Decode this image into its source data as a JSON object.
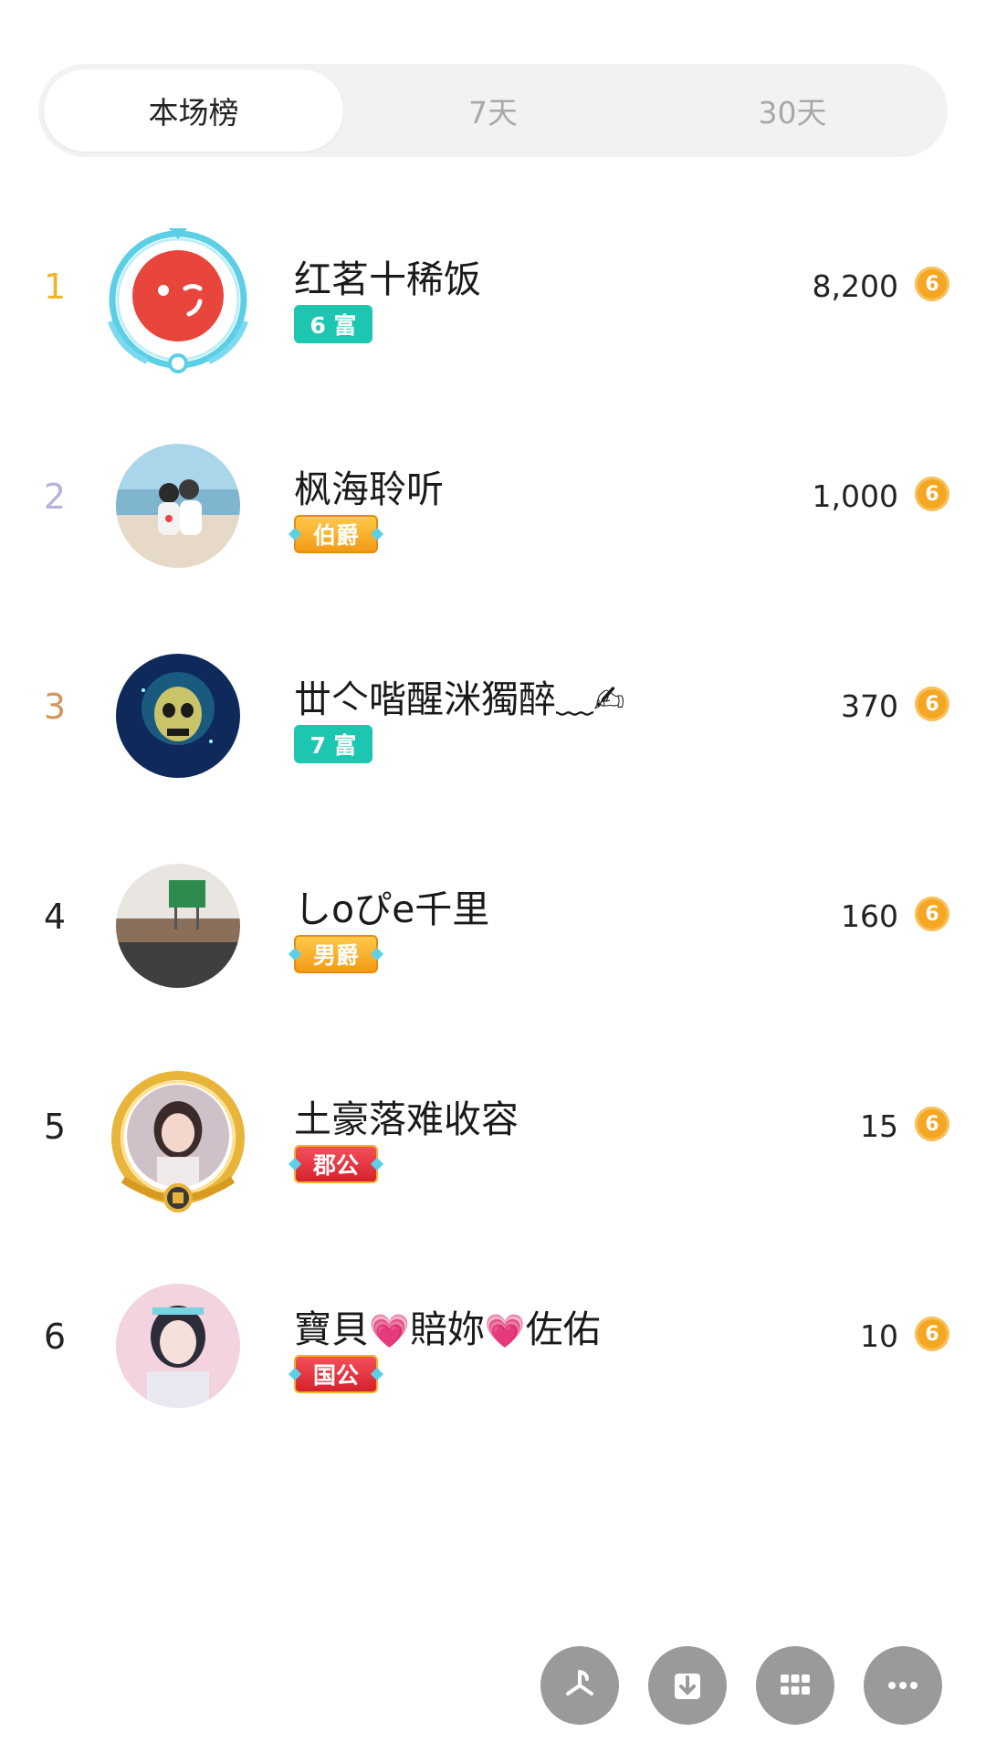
{
  "tabs": [
    {
      "label": "本场榜",
      "active": true
    },
    {
      "label": "7天",
      "active": false
    },
    {
      "label": "30天",
      "active": false
    }
  ],
  "rank_colors": {
    "first": "#f0b429",
    "second": "#b5b3dc",
    "third": "#d4955a",
    "other": "#222222"
  },
  "coin_color": "#f5a623",
  "coin_icon": "coin-icon",
  "coin_glyph": "6",
  "entries": [
    {
      "rank": "1",
      "name": "红茗十稀饭",
      "badge": "6 富",
      "badge_type": "rich",
      "score": "8,200"
    },
    {
      "rank": "2",
      "name": "枫海聆听",
      "badge": "伯爵",
      "badge_type": "noble",
      "score": "1,000"
    },
    {
      "rank": "3",
      "name": "丗亽喈醒洣獨醉﹏✍",
      "badge": "7 富",
      "badge_type": "rich",
      "score": "370"
    },
    {
      "rank": "4",
      "name": "しoぴe千里",
      "badge": "男爵",
      "badge_type": "noble",
      "score": "160"
    },
    {
      "rank": "5",
      "name": "土豪落难收容",
      "badge": "郡公",
      "badge_type": "duke",
      "score": "15"
    },
    {
      "rank": "6",
      "name_parts": [
        "寶貝",
        "💗",
        "賠妳",
        "💗",
        "佐佑"
      ],
      "badge": "国公",
      "badge_type": "duke",
      "score": "10"
    }
  ],
  "actions": [
    {
      "icon": "pinwheel-icon"
    },
    {
      "icon": "download-icon"
    },
    {
      "icon": "grid-icon"
    },
    {
      "icon": "more-icon"
    }
  ]
}
